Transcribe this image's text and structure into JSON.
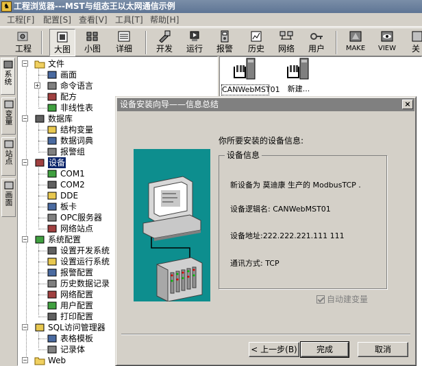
{
  "window": {
    "title": "工程浏览器---MST与组态王以太网通信示例",
    "app_icon_glyph": "♞"
  },
  "menu": [
    {
      "label": "工程[F]"
    },
    {
      "label": "配置[S]"
    },
    {
      "label": "查看[V]"
    },
    {
      "label": "工具[T]"
    },
    {
      "label": "帮助[H]"
    }
  ],
  "toolbar": [
    {
      "label": "工程",
      "icon": "project-icon"
    },
    {
      "label": "大图",
      "icon": "large-icons-icon",
      "pressed": true
    },
    {
      "label": "小图",
      "icon": "small-icons-icon"
    },
    {
      "label": "详细",
      "icon": "details-icon"
    },
    {
      "label": "开发",
      "icon": "develop-icon"
    },
    {
      "label": "运行",
      "icon": "run-icon"
    },
    {
      "label": "报警",
      "icon": "alarm-icon"
    },
    {
      "label": "历史",
      "icon": "history-icon"
    },
    {
      "label": "网络",
      "icon": "network-icon"
    },
    {
      "label": "用户",
      "icon": "user-icon"
    },
    {
      "label": "MAKE",
      "icon": "make-icon"
    },
    {
      "label": "VIEW",
      "icon": "view-icon"
    },
    {
      "label": "关",
      "icon": "close-icon"
    }
  ],
  "side_tabs": [
    {
      "label": "系统",
      "active": true
    },
    {
      "label": "变量"
    },
    {
      "label": "站点"
    },
    {
      "label": "画面"
    }
  ],
  "tree": [
    {
      "label": "文件",
      "level": 0,
      "expander": "−",
      "icon": "folder-icon"
    },
    {
      "label": "画面",
      "level": 1,
      "icon": "screen-icon"
    },
    {
      "label": "命令语言",
      "level": 1,
      "expander": "+",
      "icon": "command-language-icon"
    },
    {
      "label": "配方",
      "level": 1,
      "icon": "recipe-icon"
    },
    {
      "label": "非线性表",
      "level": 1,
      "icon": "table-icon"
    },
    {
      "label": "数据库",
      "level": 0,
      "expander": "−",
      "icon": "database-icon"
    },
    {
      "label": "结构变量",
      "level": 1,
      "icon": "struct-variable-icon"
    },
    {
      "label": "数据词典",
      "level": 1,
      "icon": "data-dictionary-icon"
    },
    {
      "label": "报警组",
      "level": 1,
      "icon": "alarm-group-icon"
    },
    {
      "label": "设备",
      "level": 0,
      "expander": "−",
      "icon": "device-icon",
      "selected": true
    },
    {
      "label": "COM1",
      "level": 1,
      "icon": "com-port-icon"
    },
    {
      "label": "COM2",
      "level": 1,
      "icon": "com-port-icon"
    },
    {
      "label": "DDE",
      "level": 1,
      "icon": "dde-icon"
    },
    {
      "label": "板卡",
      "level": 1,
      "icon": "board-card-icon"
    },
    {
      "label": "OPC服务器",
      "level": 1,
      "icon": "opc-server-icon"
    },
    {
      "label": "网络站点",
      "level": 1,
      "icon": "network-site-icon"
    },
    {
      "label": "系统配置",
      "level": 0,
      "expander": "−",
      "icon": "system-config-icon"
    },
    {
      "label": "设置开发系统",
      "level": 1,
      "icon": "dev-settings-icon"
    },
    {
      "label": "设置运行系统",
      "level": 1,
      "icon": "run-settings-icon"
    },
    {
      "label": "报警配置",
      "level": 1,
      "icon": "alarm-config-icon"
    },
    {
      "label": "历史数据记录",
      "level": 1,
      "icon": "history-record-icon"
    },
    {
      "label": "网络配置",
      "level": 1,
      "icon": "network-config-icon"
    },
    {
      "label": "用户配置",
      "level": 1,
      "icon": "user-config-icon"
    },
    {
      "label": "打印配置",
      "level": 1,
      "icon": "print-config-icon"
    },
    {
      "label": "SQL访问管理器",
      "level": 0,
      "expander": "−",
      "icon": "sql-manager-icon"
    },
    {
      "label": "表格模板",
      "level": 1,
      "icon": "table-template-icon"
    },
    {
      "label": "记录体",
      "level": 1,
      "icon": "record-icon"
    },
    {
      "label": "Web",
      "level": 0,
      "expander": "−",
      "icon": "folder-icon"
    }
  ],
  "content_items": [
    {
      "label": "CANWebMST01",
      "icon": "device-item-icon",
      "selected": true
    },
    {
      "label": "新建...",
      "icon": "new-device-icon"
    }
  ],
  "dialog": {
    "title": "设备安装向导——信息总结",
    "close_glyph": "×",
    "prompt": "你所要安装的设备信息:",
    "group_title": "设备信息",
    "lines": [
      "新设备为 莫迪康 生产的 ModbusTCP .",
      "设备逻辑名: CANWebMST01",
      "设备地址:222.222.221.111 111",
      "通讯方式:     TCP"
    ],
    "auto_var_label": "自动建变量",
    "auto_var_checked": true,
    "buttons": {
      "back": "< 上一步(B)",
      "finish": "完成",
      "cancel": "取消"
    }
  }
}
